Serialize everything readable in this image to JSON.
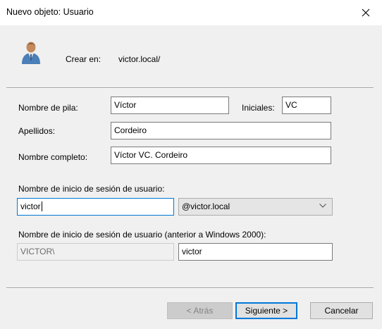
{
  "window": {
    "title": "Nuevo objeto: Usuario",
    "close_glyph": "✕"
  },
  "header": {
    "icon": "user-icon",
    "crear_en_label": "Crear en:",
    "crear_en_value": "victor.local/"
  },
  "form": {
    "first_name": {
      "label": "Nombre de pila:",
      "value": "Víctor"
    },
    "initials": {
      "label": "Iniciales:",
      "value": "VC"
    },
    "last_name": {
      "label": "Apellidos:",
      "value": "Cordeiro"
    },
    "full_name": {
      "label": "Nombre completo:",
      "value": "Víctor VC. Cordeiro"
    },
    "logon_name": {
      "label": "Nombre de inicio de sesión de usuario:",
      "value": "victor",
      "domain_selected": "@victor.local"
    },
    "pre2000_logon": {
      "label": "Nombre de inicio de sesión de usuario (anterior a Windows 2000):",
      "domain_prefix": "VICTOR\\",
      "value": "victor"
    }
  },
  "buttons": {
    "back": "< Atrás",
    "next": "Siguiente >",
    "cancel": "Cancelar"
  },
  "colors": {
    "accent": "#0078d7",
    "dialog_bg": "#f0f0f0"
  }
}
